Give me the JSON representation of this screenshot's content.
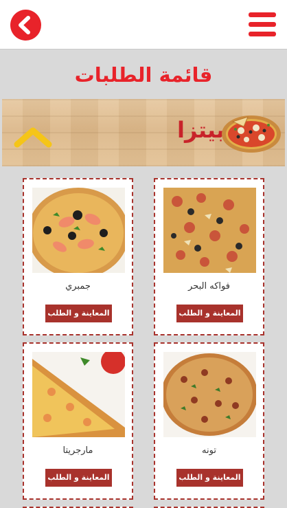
{
  "header": {
    "back_icon": "chevron-left-icon",
    "menu_icon": "hamburger-menu-icon"
  },
  "page": {
    "title": "قائمة الطلبات"
  },
  "banner": {
    "label": "بيتزا",
    "collapse_icon": "chevron-up-icon"
  },
  "products": [
    {
      "name": "جمبري",
      "button": "المعاينة و الطلب"
    },
    {
      "name": "فواكه البحر",
      "button": "المعاينة و الطلب"
    },
    {
      "name": "مارجريتا",
      "button": "المعاينة و الطلب"
    },
    {
      "name": "تونه",
      "button": "المعاينة و الطلب"
    }
  ],
  "colors": {
    "accent": "#e8232a",
    "button": "#a8322c",
    "background": "#d9d9d9",
    "chevron": "#f5c518"
  }
}
